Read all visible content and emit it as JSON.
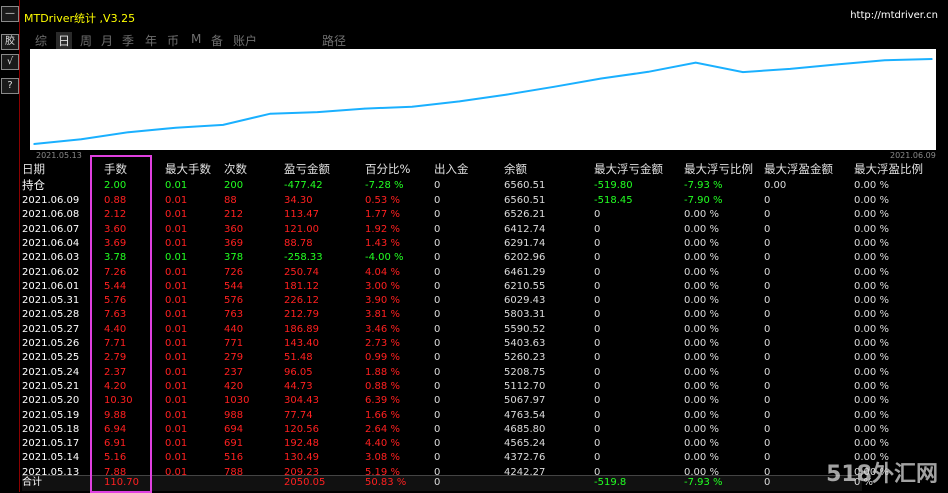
{
  "left_tools": [
    "—",
    "胶",
    "√",
    "?"
  ],
  "window": {
    "title": "MTDriver统计 ,V3.25",
    "url": "http://mtdriver.cn"
  },
  "tabs": [
    {
      "label": "综",
      "active": false
    },
    {
      "label": "日",
      "active": true
    },
    {
      "label": "周",
      "active": false
    },
    {
      "label": "月",
      "active": false
    },
    {
      "label": "季",
      "active": false
    },
    {
      "label": "年",
      "active": false
    },
    {
      "label": "币",
      "active": false
    },
    {
      "label": "M",
      "active": false
    },
    {
      "label": "备",
      "active": false
    },
    {
      "label": "账户",
      "active": false
    },
    {
      "label": "路径",
      "active": false
    }
  ],
  "chart_data": {
    "type": "line",
    "x_start_label": "2021.05.13",
    "x_end_label": "2021.06.09",
    "color": "#1ab0ff",
    "x": [
      "2021.05.13",
      "2021.05.14",
      "2021.05.17",
      "2021.05.18",
      "2021.05.19",
      "2021.05.20",
      "2021.05.21",
      "2021.05.24",
      "2021.05.25",
      "2021.05.26",
      "2021.05.27",
      "2021.05.28",
      "2021.05.31",
      "2021.06.01",
      "2021.06.02",
      "2021.06.03",
      "2021.06.04",
      "2021.06.07",
      "2021.06.08",
      "2021.06.09"
    ],
    "values": [
      4242.27,
      4372.76,
      4565.24,
      4685.8,
      4763.54,
      5067.97,
      5112.7,
      5208.75,
      5260.23,
      5403.63,
      5590.52,
      5803.31,
      6029.43,
      6210.55,
      6461.29,
      6202.96,
      6291.74,
      6412.74,
      6526.21,
      6560.51
    ]
  },
  "table": {
    "headers": [
      "日期",
      "手数",
      "最大手数",
      "次数",
      "盈亏金额",
      "百分比%",
      "出入金",
      "余额",
      "最大浮亏金额",
      "最大浮亏比例",
      "最大浮盈金额",
      "最大浮盈比例"
    ],
    "position_row": {
      "date": "持仓",
      "lots": "2.00",
      "max_lots": "0.01",
      "count": "200",
      "pl": "-477.42",
      "pct": "-7.28 %",
      "flow": "0",
      "balance": "6560.51",
      "max_float_loss": "-519.80",
      "max_float_loss_pct": "-7.93 %",
      "max_float_profit": "0.00",
      "max_float_profit_pct": "0.00 %"
    },
    "rows": [
      {
        "date": "2021.06.09",
        "lots": "0.88",
        "max_lots": "0.01",
        "count": "88",
        "pl": "34.30",
        "pct": "0.53 %",
        "flow": "0",
        "balance": "6560.51",
        "max_float_loss": "-518.45",
        "max_float_loss_pct": "-7.90 %",
        "max_float_profit": "0",
        "max_float_profit_pct": "0.00 %"
      },
      {
        "date": "2021.06.08",
        "lots": "2.12",
        "max_lots": "0.01",
        "count": "212",
        "pl": "113.47",
        "pct": "1.77 %",
        "flow": "0",
        "balance": "6526.21",
        "max_float_loss": "0",
        "max_float_loss_pct": "0.00 %",
        "max_float_profit": "0",
        "max_float_profit_pct": "0.00 %"
      },
      {
        "date": "2021.06.07",
        "lots": "3.60",
        "max_lots": "0.01",
        "count": "360",
        "pl": "121.00",
        "pct": "1.92 %",
        "flow": "0",
        "balance": "6412.74",
        "max_float_loss": "0",
        "max_float_loss_pct": "0.00 %",
        "max_float_profit": "0",
        "max_float_profit_pct": "0.00 %"
      },
      {
        "date": "2021.06.04",
        "lots": "3.69",
        "max_lots": "0.01",
        "count": "369",
        "pl": "88.78",
        "pct": "1.43 %",
        "flow": "0",
        "balance": "6291.74",
        "max_float_loss": "0",
        "max_float_loss_pct": "0.00 %",
        "max_float_profit": "0",
        "max_float_profit_pct": "0.00 %"
      },
      {
        "date": "2021.06.03",
        "lots": "3.78",
        "max_lots": "0.01",
        "count": "378",
        "pl": "-258.33",
        "pct": "-4.00 %",
        "flow": "0",
        "balance": "6202.96",
        "max_float_loss": "0",
        "max_float_loss_pct": "0.00 %",
        "max_float_profit": "0",
        "max_float_profit_pct": "0.00 %"
      },
      {
        "date": "2021.06.02",
        "lots": "7.26",
        "max_lots": "0.01",
        "count": "726",
        "pl": "250.74",
        "pct": "4.04 %",
        "flow": "0",
        "balance": "6461.29",
        "max_float_loss": "0",
        "max_float_loss_pct": "0.00 %",
        "max_float_profit": "0",
        "max_float_profit_pct": "0.00 %"
      },
      {
        "date": "2021.06.01",
        "lots": "5.44",
        "max_lots": "0.01",
        "count": "544",
        "pl": "181.12",
        "pct": "3.00 %",
        "flow": "0",
        "balance": "6210.55",
        "max_float_loss": "0",
        "max_float_loss_pct": "0.00 %",
        "max_float_profit": "0",
        "max_float_profit_pct": "0.00 %"
      },
      {
        "date": "2021.05.31",
        "lots": "5.76",
        "max_lots": "0.01",
        "count": "576",
        "pl": "226.12",
        "pct": "3.90 %",
        "flow": "0",
        "balance": "6029.43",
        "max_float_loss": "0",
        "max_float_loss_pct": "0.00 %",
        "max_float_profit": "0",
        "max_float_profit_pct": "0.00 %"
      },
      {
        "date": "2021.05.28",
        "lots": "7.63",
        "max_lots": "0.01",
        "count": "763",
        "pl": "212.79",
        "pct": "3.81 %",
        "flow": "0",
        "balance": "5803.31",
        "max_float_loss": "0",
        "max_float_loss_pct": "0.00 %",
        "max_float_profit": "0",
        "max_float_profit_pct": "0.00 %"
      },
      {
        "date": "2021.05.27",
        "lots": "4.40",
        "max_lots": "0.01",
        "count": "440",
        "pl": "186.89",
        "pct": "3.46 %",
        "flow": "0",
        "balance": "5590.52",
        "max_float_loss": "0",
        "max_float_loss_pct": "0.00 %",
        "max_float_profit": "0",
        "max_float_profit_pct": "0.00 %"
      },
      {
        "date": "2021.05.26",
        "lots": "7.71",
        "max_lots": "0.01",
        "count": "771",
        "pl": "143.40",
        "pct": "2.73 %",
        "flow": "0",
        "balance": "5403.63",
        "max_float_loss": "0",
        "max_float_loss_pct": "0.00 %",
        "max_float_profit": "0",
        "max_float_profit_pct": "0.00 %"
      },
      {
        "date": "2021.05.25",
        "lots": "2.79",
        "max_lots": "0.01",
        "count": "279",
        "pl": "51.48",
        "pct": "0.99 %",
        "flow": "0",
        "balance": "5260.23",
        "max_float_loss": "0",
        "max_float_loss_pct": "0.00 %",
        "max_float_profit": "0",
        "max_float_profit_pct": "0.00 %"
      },
      {
        "date": "2021.05.24",
        "lots": "2.37",
        "max_lots": "0.01",
        "count": "237",
        "pl": "96.05",
        "pct": "1.88 %",
        "flow": "0",
        "balance": "5208.75",
        "max_float_loss": "0",
        "max_float_loss_pct": "0.00 %",
        "max_float_profit": "0",
        "max_float_profit_pct": "0.00 %"
      },
      {
        "date": "2021.05.21",
        "lots": "4.20",
        "max_lots": "0.01",
        "count": "420",
        "pl": "44.73",
        "pct": "0.88 %",
        "flow": "0",
        "balance": "5112.70",
        "max_float_loss": "0",
        "max_float_loss_pct": "0.00 %",
        "max_float_profit": "0",
        "max_float_profit_pct": "0.00 %"
      },
      {
        "date": "2021.05.20",
        "lots": "10.30",
        "max_lots": "0.01",
        "count": "1030",
        "pl": "304.43",
        "pct": "6.39 %",
        "flow": "0",
        "balance": "5067.97",
        "max_float_loss": "0",
        "max_float_loss_pct": "0.00 %",
        "max_float_profit": "0",
        "max_float_profit_pct": "0.00 %"
      },
      {
        "date": "2021.05.19",
        "lots": "9.88",
        "max_lots": "0.01",
        "count": "988",
        "pl": "77.74",
        "pct": "1.66 %",
        "flow": "0",
        "balance": "4763.54",
        "max_float_loss": "0",
        "max_float_loss_pct": "0.00 %",
        "max_float_profit": "0",
        "max_float_profit_pct": "0.00 %"
      },
      {
        "date": "2021.05.18",
        "lots": "6.94",
        "max_lots": "0.01",
        "count": "694",
        "pl": "120.56",
        "pct": "2.64 %",
        "flow": "0",
        "balance": "4685.80",
        "max_float_loss": "0",
        "max_float_loss_pct": "0.00 %",
        "max_float_profit": "0",
        "max_float_profit_pct": "0.00 %"
      },
      {
        "date": "2021.05.17",
        "lots": "6.91",
        "max_lots": "0.01",
        "count": "691",
        "pl": "192.48",
        "pct": "4.40 %",
        "flow": "0",
        "balance": "4565.24",
        "max_float_loss": "0",
        "max_float_loss_pct": "0.00 %",
        "max_float_profit": "0",
        "max_float_profit_pct": "0.00 %"
      },
      {
        "date": "2021.05.14",
        "lots": "5.16",
        "max_lots": "0.01",
        "count": "516",
        "pl": "130.49",
        "pct": "3.08 %",
        "flow": "0",
        "balance": "4372.76",
        "max_float_loss": "0",
        "max_float_loss_pct": "0.00 %",
        "max_float_profit": "0",
        "max_float_profit_pct": "0.00 %"
      },
      {
        "date": "2021.05.13",
        "lots": "7.88",
        "max_lots": "0.01",
        "count": "788",
        "pl": "209.23",
        "pct": "5.19 %",
        "flow": "0",
        "balance": "4242.27",
        "max_float_loss": "0",
        "max_float_loss_pct": "0.00 %",
        "max_float_profit": "0",
        "max_float_profit_pct": "0.00 %"
      }
    ],
    "total_row": {
      "label": "合计",
      "lots": "110.70",
      "pl": "2050.05",
      "pct": "50.83 %",
      "flow": "0",
      "max_float_loss": "-519.8",
      "max_float_loss_pct": "-7.93 %",
      "max_float_profit": "0",
      "max_float_profit_pct": "0 %"
    }
  },
  "watermark": "518外汇网",
  "colors": {
    "profit": "#ff2020",
    "loss": "#22ff22",
    "highlight": "#e040e0",
    "title": "#ffff00"
  }
}
